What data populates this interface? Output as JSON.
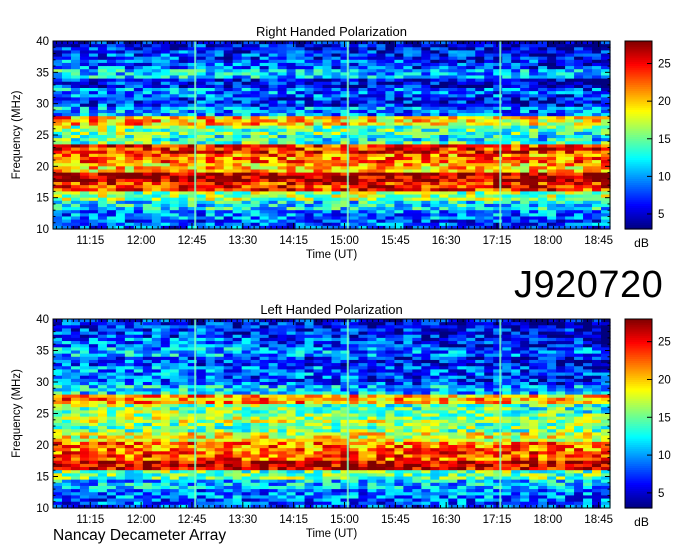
{
  "observation_id": "J920720",
  "instrument": "Nancay Decameter Array",
  "chart_data": [
    {
      "type": "heatmap",
      "title": "Right Handed Polarization",
      "xlabel": "Time (UT)",
      "ylabel": "Frequency (MHz)",
      "xticks": [
        "11:15",
        "12:00",
        "12:45",
        "13:30",
        "14:15",
        "15:00",
        "15:45",
        "16:30",
        "17:15",
        "18:00",
        "18:45"
      ],
      "xlim": [
        "10:42",
        "18:55"
      ],
      "ylim": [
        10,
        40
      ],
      "yticks": [
        10,
        15,
        20,
        25,
        30,
        35,
        40
      ],
      "colorbar": {
        "label": "dB",
        "ticks": [
          5,
          10,
          15,
          20,
          25
        ],
        "range": [
          3,
          28
        ]
      },
      "colormap": [
        "#00007f",
        "#0000ff",
        "#007fff",
        "#00ffff",
        "#7fff7f",
        "#ffff00",
        "#ff7f00",
        "#ff0000",
        "#7f0000"
      ],
      "intensity_profile_db": [
        {
          "freq": 10.5,
          "db": 8
        },
        {
          "freq": 12,
          "db": 9
        },
        {
          "freq": 13.5,
          "db": 12
        },
        {
          "freq": 15,
          "db": 16
        },
        {
          "freq": 16.5,
          "db": 24
        },
        {
          "freq": 18,
          "db": 27
        },
        {
          "freq": 19.5,
          "db": 20
        },
        {
          "freq": 21,
          "db": 22
        },
        {
          "freq": 22.5,
          "db": 24
        },
        {
          "freq": 24,
          "db": 14
        },
        {
          "freq": 25.5,
          "db": 16
        },
        {
          "freq": 27,
          "db": 21
        },
        {
          "freq": 28.5,
          "db": 11
        },
        {
          "freq": 30,
          "db": 8
        },
        {
          "freq": 31.5,
          "db": 10
        },
        {
          "freq": 33,
          "db": 7
        },
        {
          "freq": 34.5,
          "db": 12
        },
        {
          "freq": 36,
          "db": 9
        },
        {
          "freq": 37.5,
          "db": 8
        },
        {
          "freq": 39,
          "db": 7
        }
      ]
    },
    {
      "type": "heatmap",
      "title": "Left Handed Polarization",
      "xlabel": "Time (UT)",
      "ylabel": "Frequency (MHz)",
      "xticks": [
        "11:15",
        "12:00",
        "12:45",
        "13:30",
        "14:15",
        "15:00",
        "15:45",
        "16:30",
        "17:15",
        "18:00",
        "18:45"
      ],
      "xlim": [
        "10:42",
        "18:55"
      ],
      "ylim": [
        10,
        40
      ],
      "yticks": [
        10,
        15,
        20,
        25,
        30,
        35,
        40
      ],
      "colorbar": {
        "label": "dB",
        "ticks": [
          5,
          10,
          15,
          20,
          25
        ],
        "range": [
          3,
          28
        ]
      },
      "colormap": [
        "#00007f",
        "#0000ff",
        "#007fff",
        "#00ffff",
        "#7fff7f",
        "#ffff00",
        "#ff7f00",
        "#ff0000",
        "#7f0000"
      ],
      "intensity_profile_db": [
        {
          "freq": 10.5,
          "db": 8
        },
        {
          "freq": 12,
          "db": 9
        },
        {
          "freq": 13.5,
          "db": 11
        },
        {
          "freq": 15,
          "db": 15
        },
        {
          "freq": 16.5,
          "db": 26
        },
        {
          "freq": 18,
          "db": 23
        },
        {
          "freq": 19.5,
          "db": 22
        },
        {
          "freq": 21,
          "db": 18
        },
        {
          "freq": 22.5,
          "db": 15
        },
        {
          "freq": 24,
          "db": 17
        },
        {
          "freq": 25.5,
          "db": 16
        },
        {
          "freq": 27,
          "db": 22
        },
        {
          "freq": 28.5,
          "db": 12
        },
        {
          "freq": 30,
          "db": 9
        },
        {
          "freq": 31.5,
          "db": 10
        },
        {
          "freq": 33,
          "db": 8
        },
        {
          "freq": 34.5,
          "db": 11
        },
        {
          "freq": 36,
          "db": 9
        },
        {
          "freq": 37.5,
          "db": 8
        },
        {
          "freq": 39,
          "db": 7
        }
      ]
    }
  ]
}
